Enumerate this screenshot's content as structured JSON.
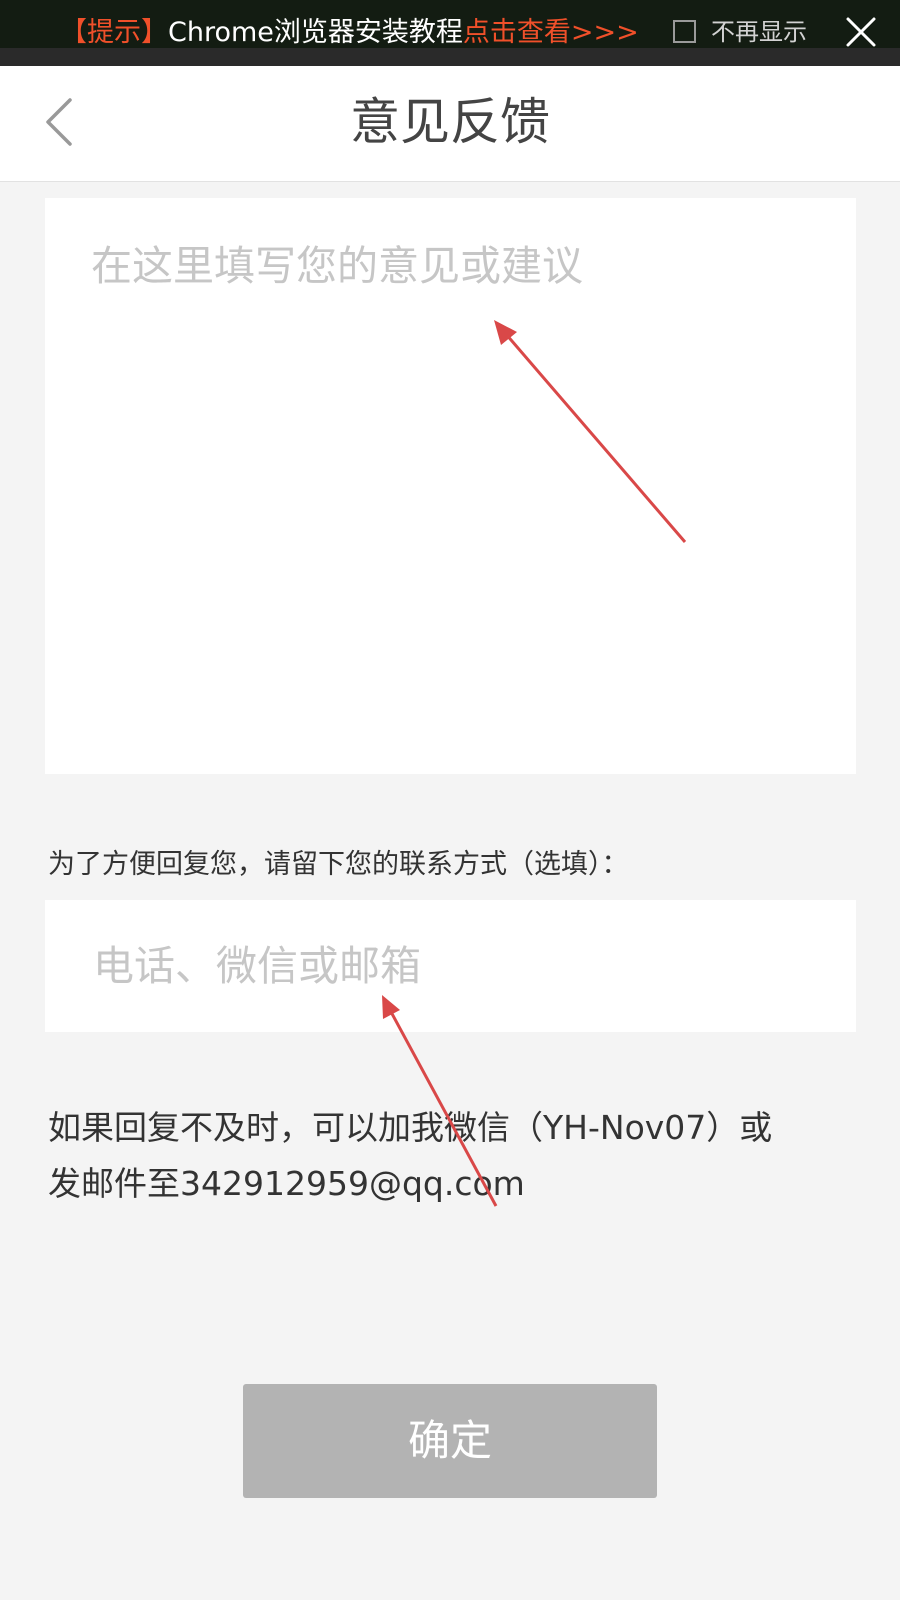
{
  "notice": {
    "tag": "【提示】",
    "text": "Chrome浏览器安装教程",
    "link": "点击查看>>>",
    "checkbox_label": "不再显示"
  },
  "header": {
    "title": "意见反馈"
  },
  "feedback": {
    "placeholder": "在这里填写您的意见或建议"
  },
  "contact": {
    "label": "为了方便回复您，请留下您的联系方式（选填）：",
    "placeholder": "电话、微信或邮箱"
  },
  "note": {
    "line1": "如果回复不及时，可以加我微信（YH-Nov07）或",
    "line2": "发邮件至342912959@qq.com"
  },
  "confirm": {
    "label": "确定"
  },
  "colors": {
    "accent": "#f0502a",
    "annotation_arrow": "#d94848",
    "button_disabled": "#b3b3b3"
  },
  "icons": {
    "back": "chevron-left-icon",
    "close": "close-icon",
    "arrow": "annotation-arrow-icon"
  }
}
